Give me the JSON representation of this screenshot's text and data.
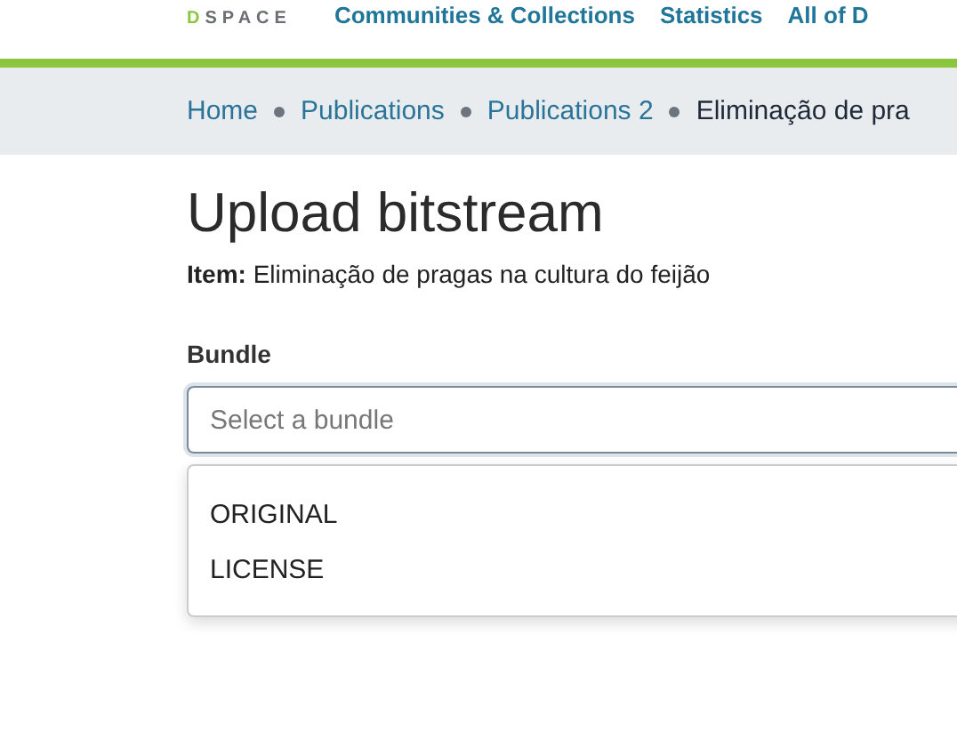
{
  "header": {
    "logo": {
      "lead": "D",
      "rest": "SPACE"
    },
    "nav": [
      "Communities & Collections",
      "Statistics",
      "All of D"
    ]
  },
  "breadcrumb": [
    {
      "label": "Home",
      "kind": "link"
    },
    {
      "label": "Publications",
      "kind": "link"
    },
    {
      "label": "Publications 2",
      "kind": "link"
    },
    {
      "label": "Eliminação de pra",
      "kind": "current"
    }
  ],
  "title": "Upload bitstream",
  "item": "**Item:** Eliminação de pragas na cultura do feijão",
  "bundle": {
    "label": "Bundle",
    "placeholder": "Select a bundle",
    "options": [
      "ORIGINAL",
      "LICENSE"
    ]
  }
}
